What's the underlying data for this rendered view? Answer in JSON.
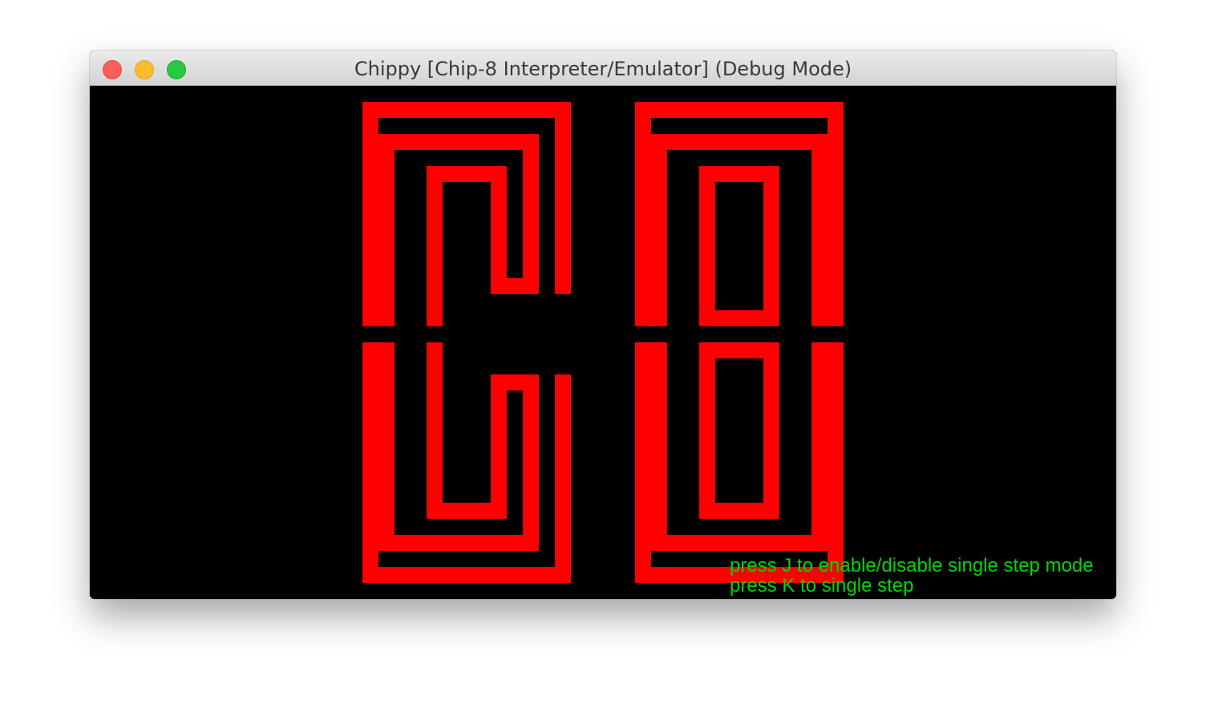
{
  "window": {
    "title": "Chippy [Chip-8 Interpreter/Emulator] (Debug Mode)"
  },
  "display": {
    "pixel_color": "#ff0000",
    "background_color": "#000000",
    "resolution": "64x32",
    "rom_display": "C8"
  },
  "debug_help": {
    "line1": "press J to enable/disable single step mode",
    "line2": "press K to single step",
    "text_color": "#00d700"
  },
  "colors": {
    "traffic_close": "#fc5f57",
    "traffic_minimize": "#fdbc2e",
    "traffic_zoom": "#28c840"
  }
}
